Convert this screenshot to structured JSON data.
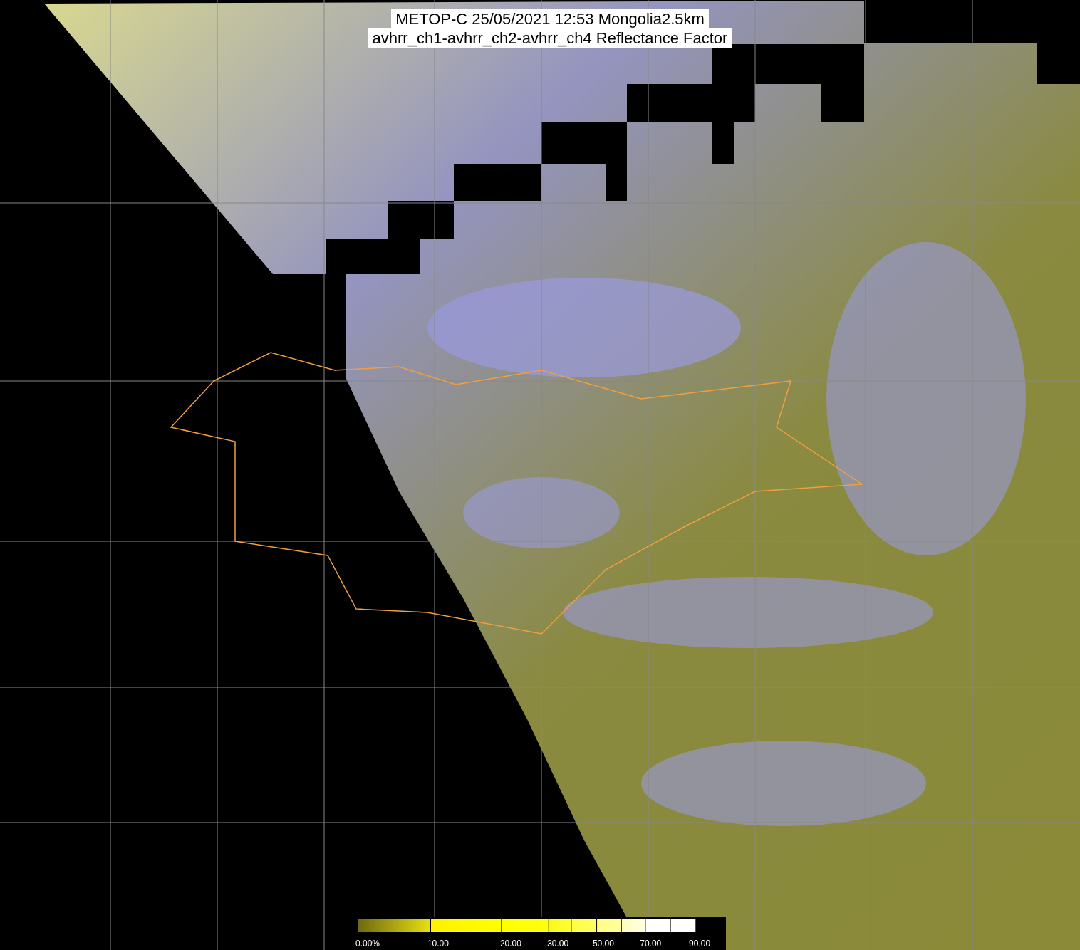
{
  "title_lines": [
    "METOP-C 25/05/2021 12:53 Mongolia2.5km",
    "avhrr_ch1-avhrr_ch2-avhrr_ch4 Reflectance Factor"
  ],
  "color_scale": {
    "ticks": [
      "0.00%",
      "10.00",
      "20.00",
      "30.00",
      "50.00",
      "70.00",
      "90.00"
    ]
  }
}
